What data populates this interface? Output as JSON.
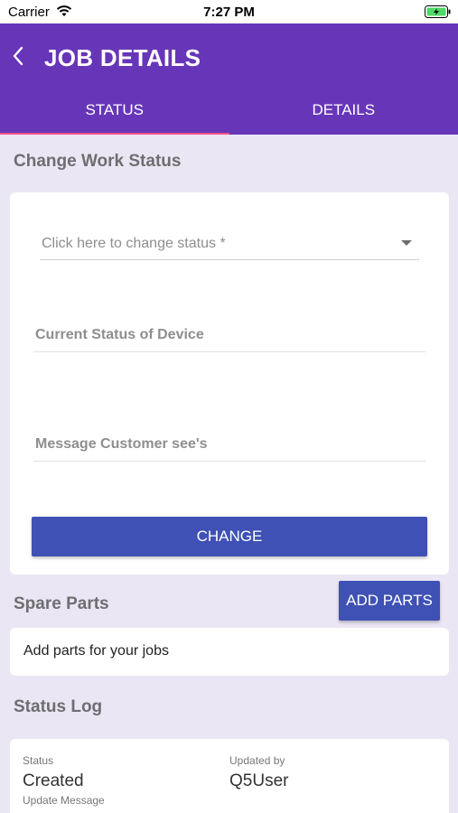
{
  "status_bar": {
    "carrier": "Carrier",
    "time": "7:27 PM"
  },
  "header": {
    "title": "JOB DETAILS"
  },
  "tabs": [
    {
      "label": "STATUS",
      "active": true
    },
    {
      "label": "DETAILS",
      "active": false
    }
  ],
  "change_status": {
    "section_title": "Change Work Status",
    "status_select": {
      "placeholder": "Click here to change status *"
    },
    "current_status_field": {
      "placeholder": "Current Status of Device"
    },
    "customer_message_field": {
      "placeholder": "Message Customer see's"
    },
    "change_button": "CHANGE"
  },
  "spare_parts": {
    "section_title": "Spare Parts",
    "add_button": "ADD PARTS",
    "empty_text": "Add parts for your jobs"
  },
  "status_log": {
    "section_title": "Status Log",
    "entries": [
      {
        "status_label": "Status",
        "status_value": "Created",
        "updated_by_label": "Updated by",
        "updated_by_value": "Q5User",
        "update_message_label": "Update Message"
      }
    ]
  },
  "colors": {
    "primary": "#6736b8",
    "accent_button": "#3f51b5",
    "tab_indicator": "#ff4f86",
    "page_background": "#ebe6f4",
    "battery_green": "#4cd964"
  },
  "icons": {
    "back": "chevron-left-icon",
    "wifi": "wifi-icon",
    "battery": "battery-charging-icon",
    "dropdown": "caret-down-icon"
  }
}
